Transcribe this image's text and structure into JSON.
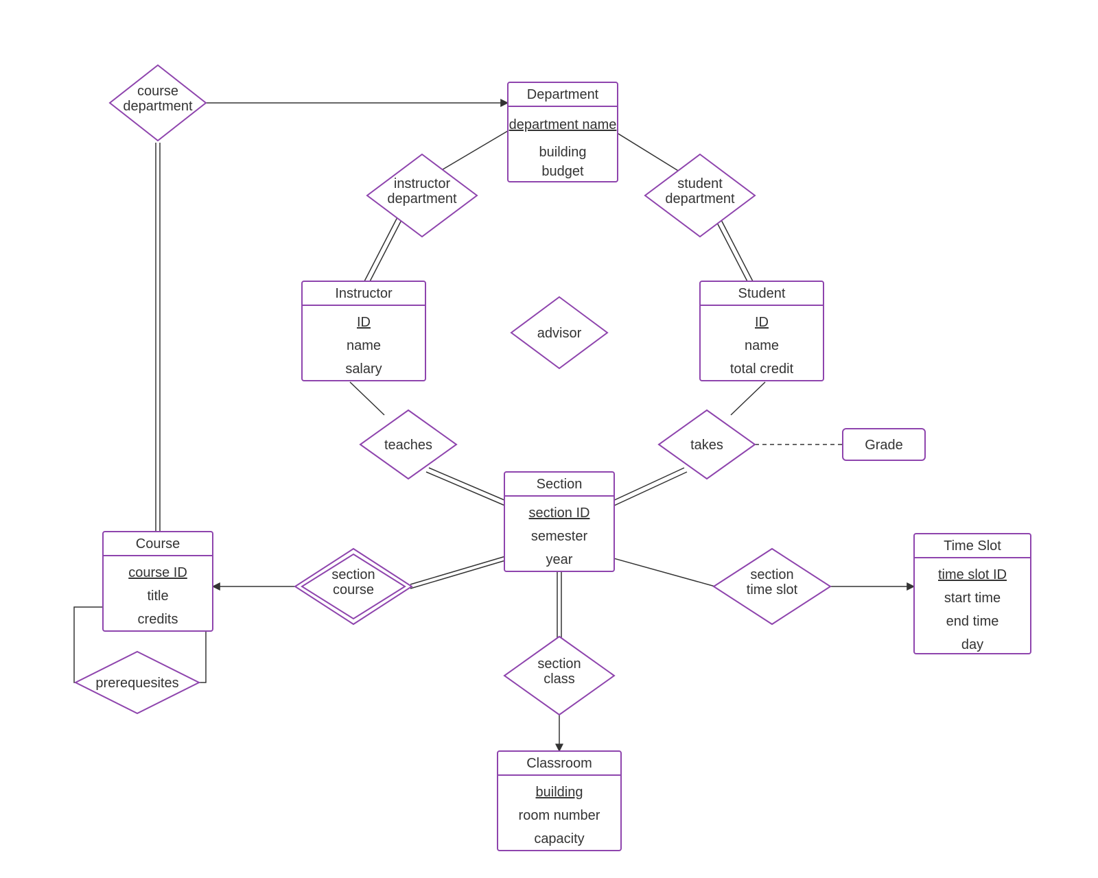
{
  "entities": {
    "department": {
      "title": "Department",
      "attrs": [
        "department name",
        "building",
        "budget"
      ],
      "pk": [
        0
      ]
    },
    "instructor": {
      "title": "Instructor",
      "attrs": [
        "ID",
        "name",
        "salary"
      ],
      "pk": [
        0
      ]
    },
    "student": {
      "title": "Student",
      "attrs": [
        "ID",
        "name",
        "total credit"
      ],
      "pk": [
        0
      ]
    },
    "section": {
      "title": "Section",
      "attrs": [
        "section ID",
        "semester",
        "year"
      ],
      "pk": [
        0
      ]
    },
    "course": {
      "title": "Course",
      "attrs": [
        "course ID",
        "title",
        "credits"
      ],
      "pk": [
        0
      ]
    },
    "timeslot": {
      "title": "Time Slot",
      "attrs": [
        "time slot ID",
        "start time",
        "end time",
        "day"
      ],
      "pk": [
        0
      ]
    },
    "classroom": {
      "title": "Classroom",
      "attrs": [
        "building",
        "room number",
        "capacity"
      ],
      "pk": [
        0
      ]
    },
    "grade": {
      "title": "Grade"
    }
  },
  "relationships": {
    "course_department": "course\ndepartment",
    "instructor_department": "instructor\ndepartment",
    "student_department": "student\ndepartment",
    "advisor": "advisor",
    "teaches": "teaches",
    "takes": "takes",
    "section_course": "section\ncourse",
    "section_timeslot": "section\ntime slot",
    "section_class": "section\nclass",
    "prerequisites": "prerequesites"
  }
}
